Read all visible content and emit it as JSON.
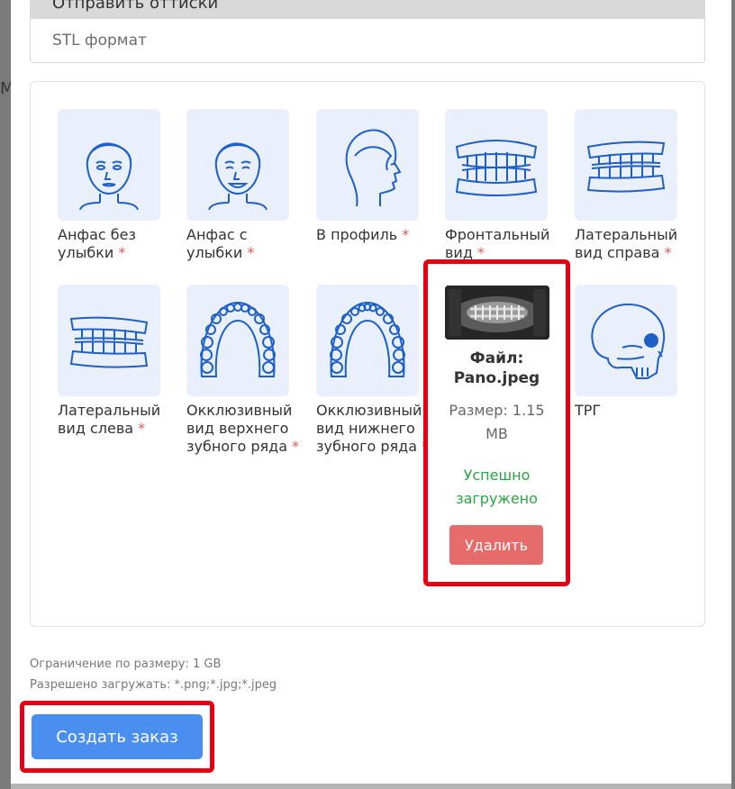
{
  "impressions": {
    "header": "Отправить оттиски",
    "format": "STL формат"
  },
  "tiles": [
    {
      "label": "Анфас без улыбки",
      "required": "*",
      "icon": "face-neutral-icon"
    },
    {
      "label": "Анфас с улыбки",
      "required": "*",
      "icon": "face-smile-icon"
    },
    {
      "label": "В профиль",
      "required": "*",
      "icon": "face-profile-icon"
    },
    {
      "label": "Фронтальный вид",
      "required": "*",
      "icon": "teeth-front-icon"
    },
    {
      "label": "Латеральный вид справа",
      "required": "*",
      "icon": "teeth-right-icon"
    },
    {
      "label": "Латеральный вид слева",
      "required": "*",
      "icon": "teeth-left-icon"
    },
    {
      "label": "Окклюзивный вид верхнего зубного ряда",
      "required": "*",
      "icon": "upper-arch-icon"
    },
    {
      "label": "Окклюзивный вид нижнего зубного ряда",
      "required": "*",
      "icon": "lower-arch-icon"
    },
    {
      "label": "ТРГ",
      "required": "",
      "icon": "skull-icon"
    }
  ],
  "upload": {
    "file_name": "Файл: Pano.jpeg",
    "size": "Размер: 1.15 MB",
    "status": "Успешно загружено",
    "delete_label": "Удалить"
  },
  "limits": {
    "size_limit": "Ограничение по размеру: 1 GB",
    "allowed": "Разрешено загружать: *.png;*.jpg;*.jpeg"
  },
  "submit_label": "Создать заказ",
  "colors": {
    "accent": "#4a8ff0",
    "danger": "#e66b6b",
    "success": "#28a745",
    "highlight": "#e60012",
    "tile_bg": "#e9f0fb",
    "icon_stroke": "#1f5fc8"
  }
}
